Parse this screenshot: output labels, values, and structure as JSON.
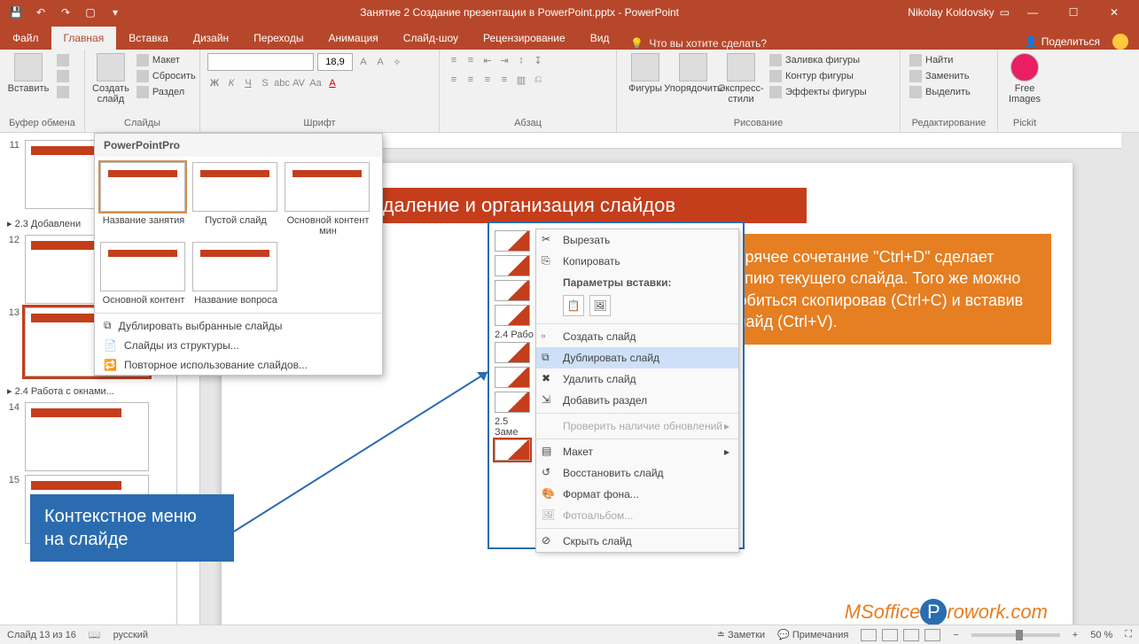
{
  "title": "Занятие 2 Создание презентации в PowerPoint.pptx  -  PowerPoint",
  "user": "Nikolay Koldovsky",
  "tabs": [
    "Файл",
    "Главная",
    "Вставка",
    "Дизайн",
    "Переходы",
    "Анимация",
    "Слайд-шоу",
    "Рецензирование",
    "Вид"
  ],
  "active_tab": 1,
  "tellme": "Что вы хотите сделать?",
  "share": "Поделиться",
  "ribbon": {
    "clipboard": {
      "paste": "Вставить",
      "label": "Буфер обмена"
    },
    "slides": {
      "new": "Создать слайд",
      "layout": "Макет",
      "reset": "Сбросить",
      "section": "Раздел",
      "label": "Слайды"
    },
    "font": {
      "size": "18,9",
      "label": "Шрифт"
    },
    "paragraph": {
      "label": "Абзац"
    },
    "drawing": {
      "shapes": "Фигуры",
      "arrange": "Упорядочить",
      "styles": "Экспресс-стили",
      "fill": "Заливка фигуры",
      "outline": "Контур фигуры",
      "effects": "Эффекты фигуры",
      "label": "Рисование"
    },
    "editing": {
      "find": "Найти",
      "replace": "Заменить",
      "select": "Выделить",
      "label": "Редактирование"
    },
    "pickit": {
      "free": "Free Images",
      "label": "Pickit"
    }
  },
  "gallery": {
    "head": "PowerPointPro",
    "items": [
      "Название занятия",
      "Пустой слайд",
      "Основной контент мин",
      "Основной контент",
      "Название вопроса"
    ],
    "menu": [
      "Дублировать выбранные слайды",
      "Слайды из структуры...",
      "Повторное использование слайдов..."
    ]
  },
  "thumbs": {
    "sections": [
      "2.3 Добавлени",
      "2.4 Работа с окнами..."
    ],
    "nums": [
      "11",
      "12",
      "13",
      "14",
      "15"
    ]
  },
  "slide": {
    "title": "авление, удаление и организация слайдов",
    "tip": "Горячее сочетание \"Ctrl+D\" сделает копию текущего слайда. Того же можно добиться скопировав (Ctrl+C) и вставив слайд (Ctrl+V).",
    "callout": "Контекстное меню на слайде",
    "logo1": "MSoffice",
    "logo2": "rowork.com",
    "panel_labels": [
      "2.4 Рабо",
      "2.5 Заме"
    ]
  },
  "context_menu": {
    "cut": "Вырезать",
    "copy": "Копировать",
    "paste_head": "Параметры вставки:",
    "new": "Создать слайд",
    "dup": "Дублировать слайд",
    "del": "Удалить слайд",
    "section": "Добавить раздел",
    "update": "Проверить наличие обновлений",
    "layout": "Макет",
    "restore": "Восстановить слайд",
    "format": "Формат фона...",
    "album": "Фотоальбом...",
    "hide": "Скрыть слайд"
  },
  "status": {
    "slide": "Слайд 13 из 16",
    "lang": "русский",
    "notes": "Заметки",
    "comments": "Примечания",
    "zoom": "50 %"
  }
}
